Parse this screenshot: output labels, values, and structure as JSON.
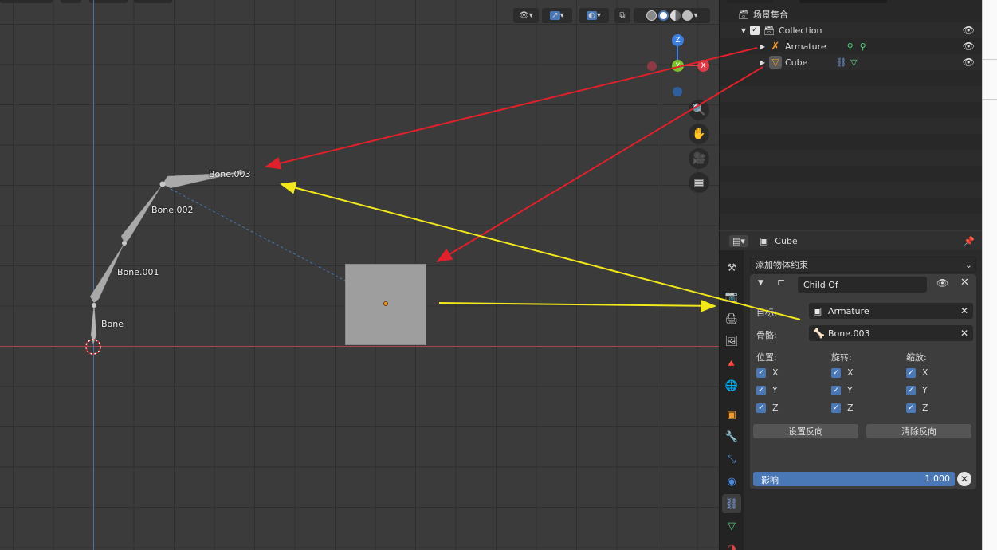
{
  "viewport": {
    "bones": [
      {
        "name": "bone",
        "label": "Bone"
      },
      {
        "name": "bone-001",
        "label": "Bone.001"
      },
      {
        "name": "bone-002",
        "label": "Bone.002"
      },
      {
        "name": "bone-003",
        "label": "Bone.003"
      }
    ],
    "gizmo": {
      "z": "Z",
      "y": "Y",
      "x": "X"
    }
  },
  "outliner": {
    "scene_collection": "场景集合",
    "collection": "Collection",
    "armature": "Armature",
    "cube": "Cube"
  },
  "properties": {
    "object_name": "Cube",
    "add_constraint": "添加物体约束",
    "constraint_name": "Child Of",
    "target_label": "目标:",
    "target_value": "Armature",
    "bone_label": "骨骼:",
    "bone_value": "Bone.003",
    "location_label": "位置:",
    "rotation_label": "旋转:",
    "scale_label": "缩放:",
    "axes": [
      "X",
      "Y",
      "Z"
    ],
    "set_inverse": "设置反向",
    "clear_inverse": "清除反向",
    "influence_label": "影响",
    "influence_value": "1.000"
  },
  "colors": {
    "accent_blue": "#4a78b6",
    "annotation_red": "#e0202a",
    "annotation_yellow": "#f2e81c",
    "object_orange": "#f29a2a",
    "mesh_green": "#55d07a"
  }
}
